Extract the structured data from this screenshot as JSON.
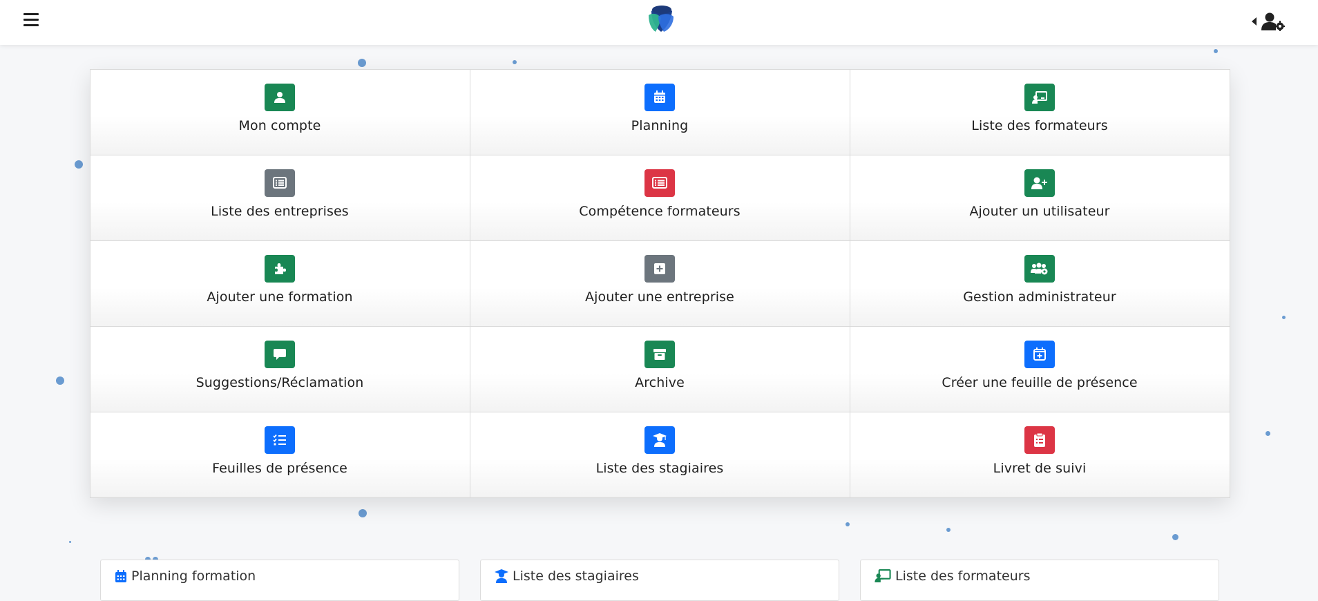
{
  "header": {
    "menu_icon": "hamburger-icon",
    "logo": "app-logo",
    "user_icon": "user-settings-icon",
    "caret_icon": "caret-left-icon"
  },
  "tiles": [
    {
      "label": "Mon compte",
      "icon": "user-icon",
      "color": "#198754"
    },
    {
      "label": "Planning",
      "icon": "calendar-icon",
      "color": "#0d6efd"
    },
    {
      "label": "Liste des formateurs",
      "icon": "chalkboard-teacher-icon",
      "color": "#198754"
    },
    {
      "label": "Liste des entreprises",
      "icon": "list-icon",
      "color": "#6c757d"
    },
    {
      "label": "Compétence formateurs",
      "icon": "rectangle-list-icon",
      "color": "#dc3545"
    },
    {
      "label": "Ajouter un utilisateur",
      "icon": "user-plus-icon",
      "color": "#198754"
    },
    {
      "label": "Ajouter une formation",
      "icon": "puzzle-icon",
      "color": "#198754"
    },
    {
      "label": "Ajouter une entreprise",
      "icon": "plus-square-icon",
      "color": "#6c757d"
    },
    {
      "label": "Gestion administrateur",
      "icon": "users-gear-icon",
      "color": "#198754"
    },
    {
      "label": "Suggestions/Réclamation",
      "icon": "comment-icon",
      "color": "#198754"
    },
    {
      "label": "Archive",
      "icon": "archive-icon",
      "color": "#198754"
    },
    {
      "label": "Créer une feuille de présence",
      "icon": "calendar-plus-icon",
      "color": "#0d6efd"
    },
    {
      "label": "Feuilles de présence",
      "icon": "list-check-icon",
      "color": "#0d6efd"
    },
    {
      "label": "Liste des stagiaires",
      "icon": "user-graduate-icon",
      "color": "#0d6efd"
    },
    {
      "label": "Livret de suivi",
      "icon": "clipboard-icon",
      "color": "#dc3545"
    }
  ],
  "bottom_cards": [
    {
      "title": "Planning formation",
      "icon": "calendar-icon",
      "color": "#0d6efd"
    },
    {
      "title": "Liste des stagiaires",
      "icon": "user-graduate-icon",
      "color": "#0d6efd"
    },
    {
      "title": "Liste des formateurs",
      "icon": "chalkboard-teacher-icon",
      "color": "#198754"
    }
  ]
}
